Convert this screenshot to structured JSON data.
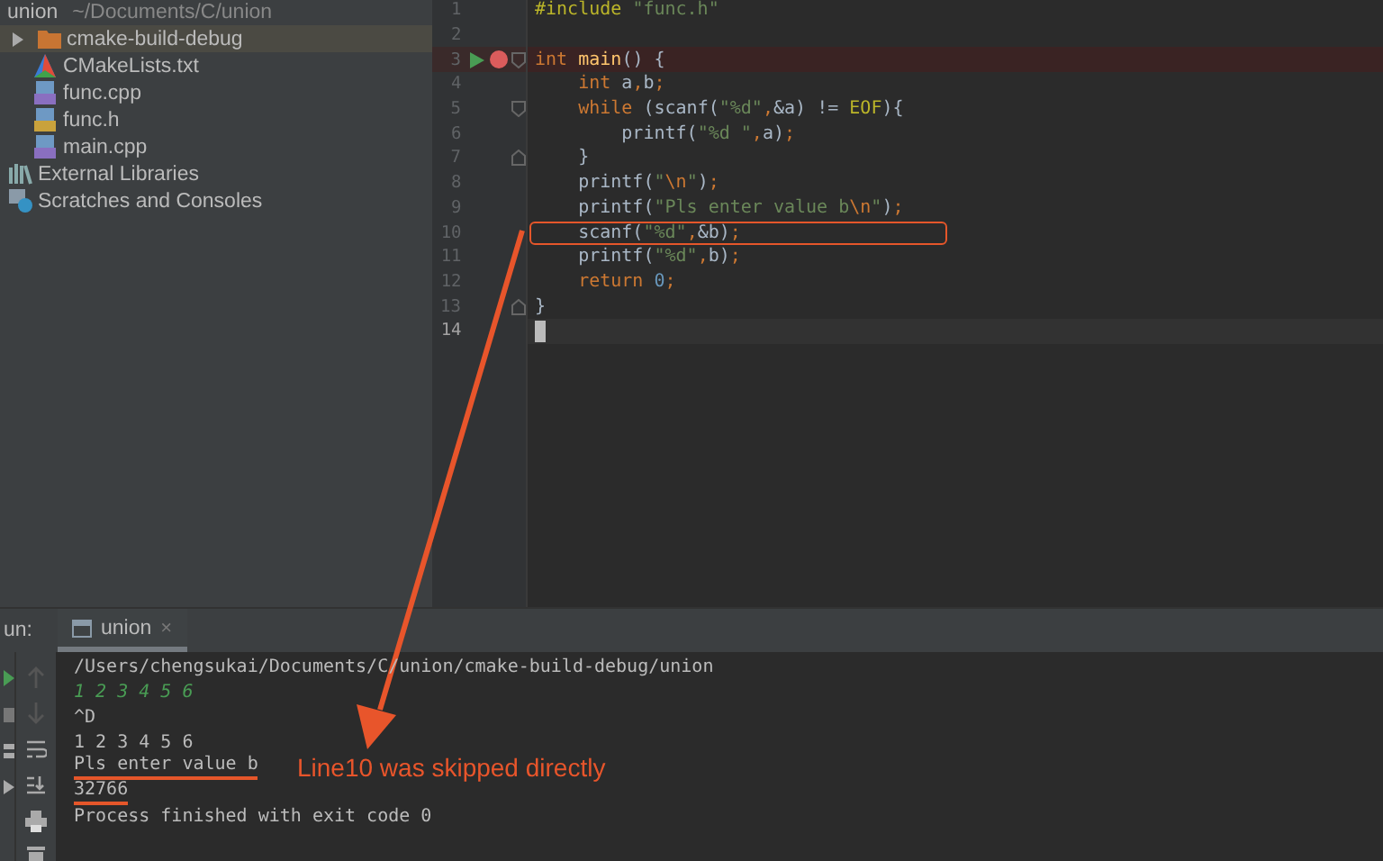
{
  "project": {
    "root": {
      "name": "union",
      "path": "~/Documents/C/union",
      "children": [
        {
          "name": "cmake-build-debug",
          "kind": "folder",
          "selected": true,
          "expanded": false
        },
        {
          "name": "CMakeLists.txt",
          "kind": "cmake",
          "selected": false
        },
        {
          "name": "func.cpp",
          "kind": "cpp",
          "selected": false
        },
        {
          "name": "func.h",
          "kind": "header",
          "selected": false
        },
        {
          "name": "main.cpp",
          "kind": "cpp",
          "selected": false
        }
      ]
    },
    "extra": [
      {
        "name": "External Libraries",
        "kind": "library",
        "selected": false
      },
      {
        "name": "Scratches and Consoles",
        "kind": "scratches",
        "selected": false
      }
    ]
  },
  "editor": {
    "lines": [
      {
        "number": "1",
        "tokens": [
          {
            "kind": "pre",
            "t": "#include "
          },
          {
            "kind": "str",
            "t": "\"func.h\""
          }
        ]
      },
      {
        "number": "2"
      },
      {
        "number": "3",
        "runnable": true,
        "breakpoint": true,
        "fold_start": true,
        "tokens": [
          {
            "kind": "kw",
            "t": "int "
          },
          {
            "kind": "fn",
            "t": "main"
          },
          {
            "kind": "pl",
            "t": "() {"
          }
        ]
      },
      {
        "number": "4",
        "tokens": [
          {
            "kind": "kw",
            "t": "    int "
          },
          {
            "kind": "pl",
            "t": "a"
          },
          {
            "kind": "kw",
            "t": ","
          },
          {
            "kind": "pl",
            "t": "b"
          },
          {
            "kind": "kw",
            "t": ";"
          }
        ]
      },
      {
        "number": "5",
        "fold_start": true,
        "tokens": [
          {
            "kind": "kw",
            "t": "    while "
          },
          {
            "kind": "pl",
            "t": "(scanf("
          },
          {
            "kind": "str",
            "t": "\"%d\""
          },
          {
            "kind": "kw",
            "t": ","
          },
          {
            "kind": "pl",
            "t": "&a) != "
          },
          {
            "kind": "mac",
            "t": "EOF"
          },
          {
            "kind": "pl",
            "t": "){"
          }
        ]
      },
      {
        "number": "6",
        "tokens": [
          {
            "kind": "pl",
            "t": "        printf("
          },
          {
            "kind": "str",
            "t": "\"%d \""
          },
          {
            "kind": "kw",
            "t": ","
          },
          {
            "kind": "pl",
            "t": "a)"
          },
          {
            "kind": "kw",
            "t": ";"
          }
        ]
      },
      {
        "number": "7",
        "fold_end": true,
        "tokens": [
          {
            "kind": "pl",
            "t": "    }"
          }
        ]
      },
      {
        "number": "8",
        "tokens": [
          {
            "kind": "pl",
            "t": "    printf("
          },
          {
            "kind": "str",
            "t": "\""
          },
          {
            "kind": "esc",
            "t": "\\n"
          },
          {
            "kind": "str",
            "t": "\""
          },
          {
            "kind": "pl",
            "t": ")"
          },
          {
            "kind": "kw",
            "t": ";"
          }
        ]
      },
      {
        "number": "9",
        "tokens": [
          {
            "kind": "pl",
            "t": "    printf("
          },
          {
            "kind": "str",
            "t": "\"Pls enter value b"
          },
          {
            "kind": "esc",
            "t": "\\n"
          },
          {
            "kind": "str",
            "t": "\""
          },
          {
            "kind": "pl",
            "t": ")"
          },
          {
            "kind": "kw",
            "t": ";"
          }
        ]
      },
      {
        "number": "10",
        "boxed": true,
        "tokens": [
          {
            "kind": "pl",
            "t": "    scanf("
          },
          {
            "kind": "str",
            "t": "\"%d\""
          },
          {
            "kind": "kw",
            "t": ","
          },
          {
            "kind": "pl",
            "t": "&b)"
          },
          {
            "kind": "kw",
            "t": ";"
          }
        ]
      },
      {
        "number": "11",
        "tokens": [
          {
            "kind": "pl",
            "t": "    printf("
          },
          {
            "kind": "str",
            "t": "\"%d\""
          },
          {
            "kind": "kw",
            "t": ","
          },
          {
            "kind": "pl",
            "t": "b)"
          },
          {
            "kind": "kw",
            "t": ";"
          }
        ]
      },
      {
        "number": "12",
        "tokens": [
          {
            "kind": "kw",
            "t": "    return "
          },
          {
            "kind": "num",
            "t": "0"
          },
          {
            "kind": "kw",
            "t": ";"
          }
        ]
      },
      {
        "number": "13",
        "fold_end": true,
        "tokens": [
          {
            "kind": "pl",
            "t": "}"
          }
        ]
      },
      {
        "number": "14",
        "current": true
      }
    ]
  },
  "run": {
    "label": "un:",
    "tab": {
      "title": "union",
      "close": "×",
      "selected": true
    },
    "output": [
      {
        "kind": "system",
        "text": "/Users/chengsukai/Documents/C/union/cmake-build-debug/union",
        "underlined": false
      },
      {
        "kind": "input",
        "text": "1 2 3 4 5 6",
        "underlined": false
      },
      {
        "kind": "output",
        "text": "^D",
        "underlined": false
      },
      {
        "kind": "output",
        "text": "1 2 3 4 5 6",
        "underlined": false
      },
      {
        "kind": "output",
        "text": "Pls enter value b",
        "underlined": true
      },
      {
        "kind": "output",
        "text": "32766",
        "underlined": true
      },
      {
        "kind": "output",
        "text": "Process finished with exit code 0",
        "underlined": false
      }
    ]
  },
  "annotation": {
    "callout": "Line10 was skipped directly"
  }
}
